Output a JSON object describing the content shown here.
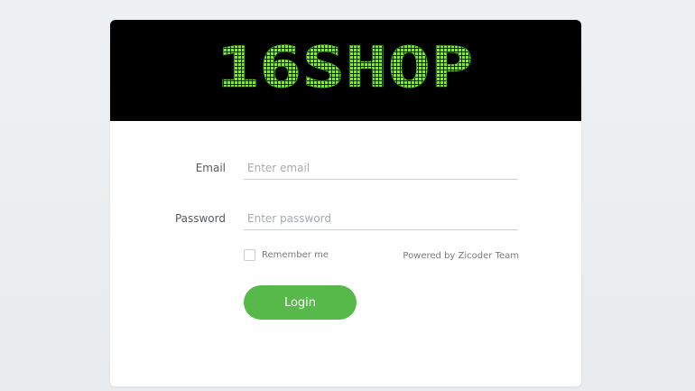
{
  "brand": {
    "logo_text": "16SHOP",
    "banner_color": "#000000",
    "logo_color": "#7ddc3a"
  },
  "form": {
    "email_label": "Email",
    "email_placeholder": "Enter email",
    "email_value": "",
    "password_label": "Password",
    "password_placeholder": "Enter password",
    "password_value": "",
    "remember_label": "Remember me",
    "remember_checked": false,
    "powered_by": "Powered by Zicoder Team",
    "login_label": "Login",
    "accent_color": "#56b949"
  }
}
